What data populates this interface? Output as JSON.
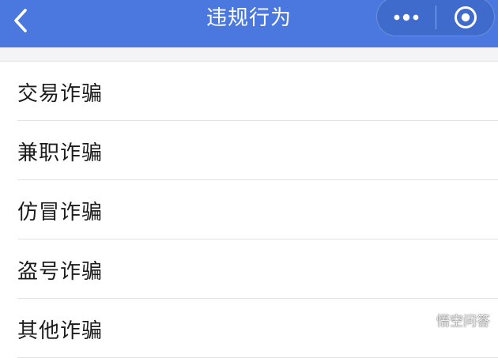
{
  "nav": {
    "title": "违规行为",
    "back_icon": "chevron-left-icon",
    "more_icon": "more-dots-icon",
    "record_icon": "target-circle-icon",
    "background_color": "#4a78de"
  },
  "menu": {
    "items": [
      {
        "label": "交易诈骗"
      },
      {
        "label": "兼职诈骗"
      },
      {
        "label": "仿冒诈骗"
      },
      {
        "label": "盗号诈骗"
      },
      {
        "label": "其他诈骗"
      }
    ]
  },
  "watermark": {
    "text": "悟空问答"
  }
}
